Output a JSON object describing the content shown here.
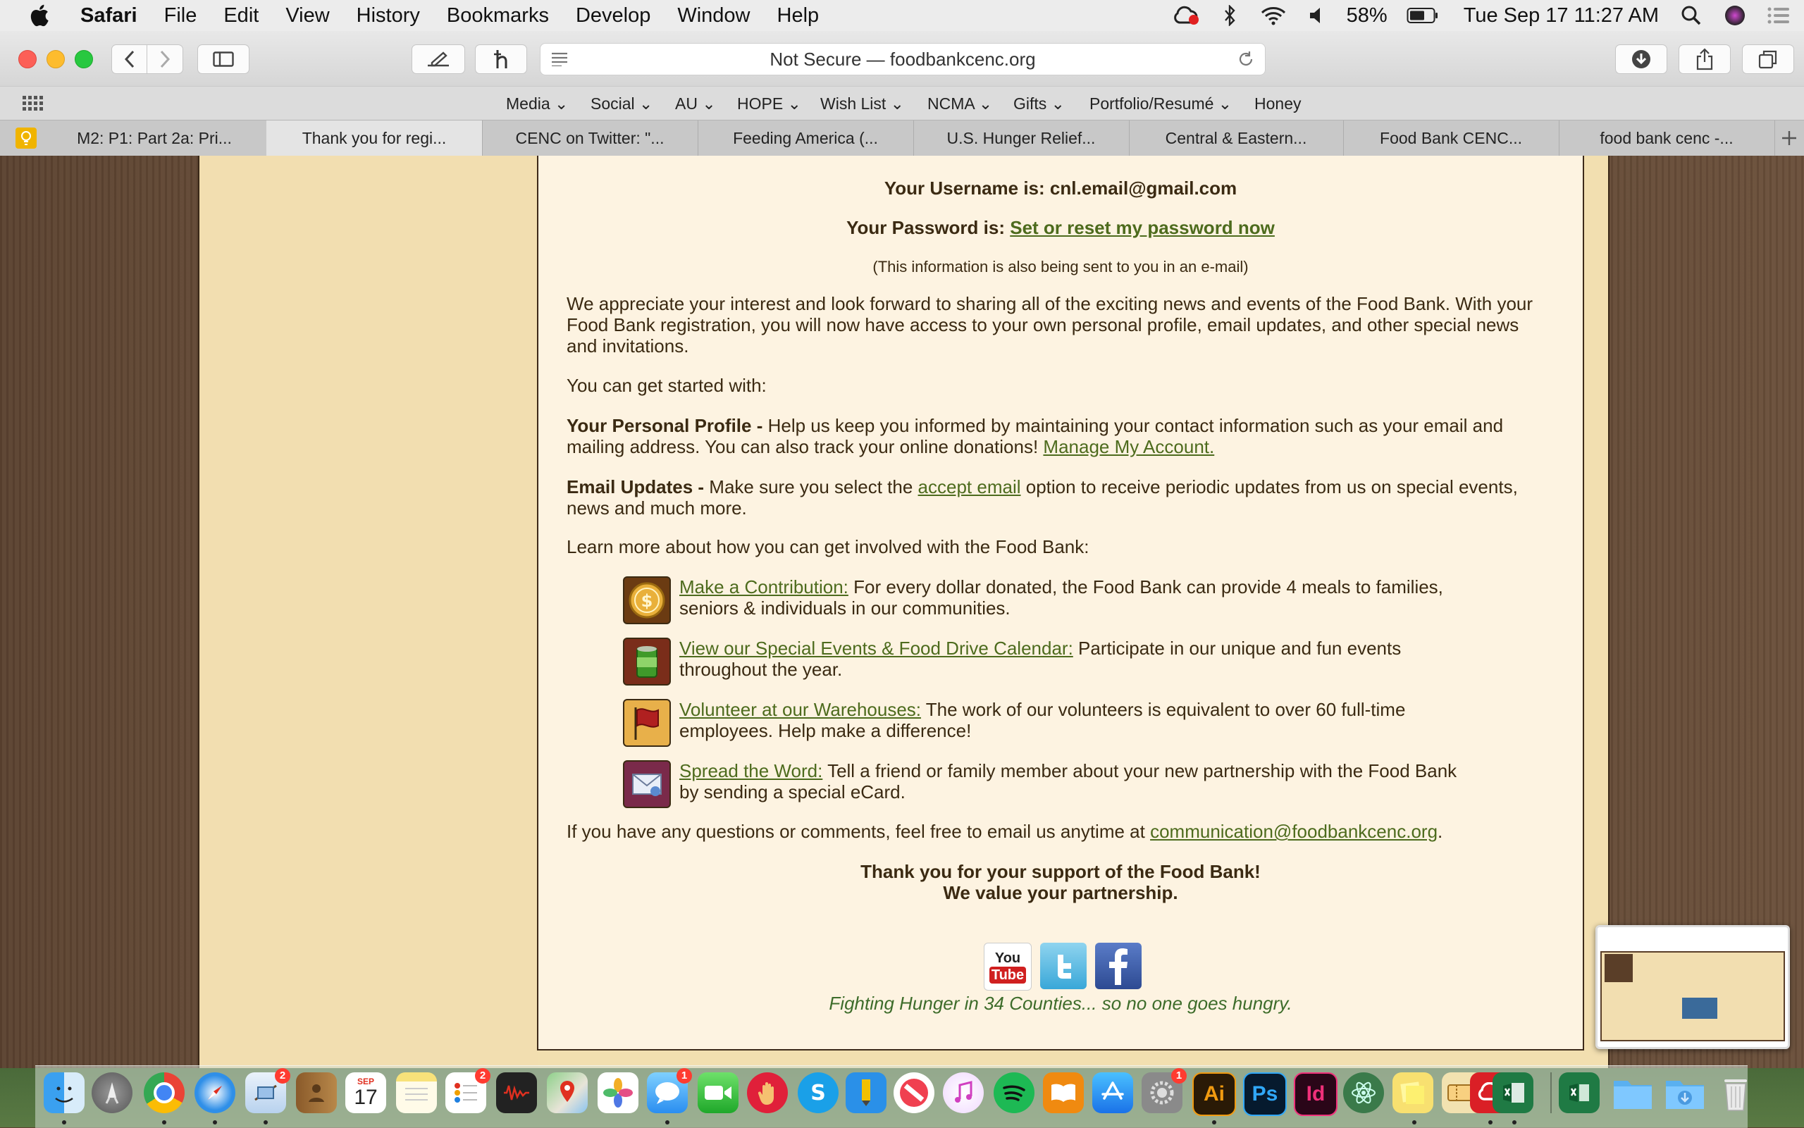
{
  "menubar": {
    "app_name": "Safari",
    "items": [
      "File",
      "Edit",
      "View",
      "History",
      "Bookmarks",
      "Develop",
      "Window",
      "Help"
    ],
    "battery": "58%",
    "datetime": "Tue Sep 17  11:27 AM"
  },
  "toolbar": {
    "address": "Not Secure — foodbankcenc.org"
  },
  "favorites": [
    "Media",
    "Social",
    "AU",
    "HOPE",
    "Wish List",
    "NCMA",
    "Gifts",
    "Portfolio/Resumé",
    "Honey"
  ],
  "tabs": [
    "M2: P1: Part 2a: Pri...",
    "Thank you for regi...",
    "CENC on Twitter: \"...",
    "Feeding America (...",
    "U.S. Hunger Relief...",
    "Central & Eastern...",
    "Food Bank CENC...",
    "food bank cenc -..."
  ],
  "page": {
    "username_label": "Your Username is:",
    "username_value": "cnl.email@gmail.com",
    "password_label": "Your Password is:",
    "password_link": "Set or reset my password now",
    "info_note": "(This information is also being sent to you in an e-mail)",
    "intro": "We appreciate your interest and look forward to sharing all of the exciting news and events of the Food Bank. With your Food Bank registration, you will now have access to your own personal profile, email updates, and other special news and invitations.",
    "get_started": "You can get started with:",
    "profile_label": "Your Personal Profile -",
    "profile_text": " Help us keep you informed by maintaining your contact information such as your email and mailing address.  You can also track your online donations! ",
    "profile_link": "Manage My Account.",
    "email_label": "Email Updates -",
    "email_text_1": " Make sure you select the ",
    "email_link": "accept email",
    "email_text_2": " option to receive periodic updates from us on special events, news and much more.",
    "learn_more": "Learn more about how you can get involved with the Food Bank:",
    "options": [
      {
        "link": "Make a Contribution:",
        "text": " For every dollar donated, the Food Bank can provide 4 meals to families, seniors & individuals in our communities."
      },
      {
        "link": "View our Special Events & Food Drive Calendar:",
        "text": " Participate in our unique and fun events throughout the year."
      },
      {
        "link": "Volunteer at our Warehouses:",
        "text": " The work of our volunteers is equivalent to over 60 full-time employees. Help make a difference!"
      },
      {
        "link": "Spread the Word:",
        "text": " Tell a friend or family member about your new partnership with the Food Bank by sending a special eCard."
      }
    ],
    "questions_text": "If you have any questions or comments, feel free to email us anytime at ",
    "questions_email": "communication@foodbankcenc.org",
    "questions_end": ".",
    "thanks_1": "Thank you for your support of the Food Bank!",
    "thanks_2": "We value your partnership.",
    "youtube_label_1": "You",
    "youtube_label_2": "Tube",
    "tagline": "Fighting Hunger in 34 Counties... so no one goes hungry."
  },
  "dock": {
    "mail_badge": "2",
    "reminders_badge": "2",
    "messages_badge": "1",
    "prefs_badge": "1",
    "calendar_month": "SEP",
    "calendar_day": "17",
    "illustrator": "Ai",
    "photoshop": "Ps",
    "indesign": "Id"
  }
}
